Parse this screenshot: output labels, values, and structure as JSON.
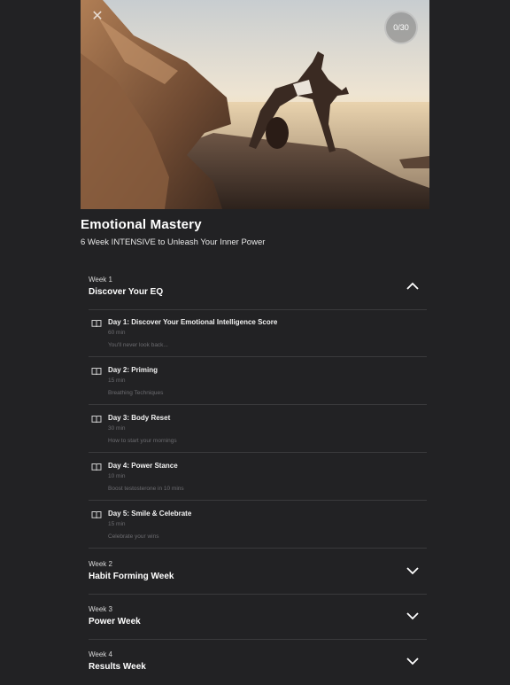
{
  "header": {
    "progress": "0/30"
  },
  "course": {
    "title": "Emotional Mastery",
    "subtitle": "6 Week INTENSIVE to Unleash Your Inner Power"
  },
  "weeks": [
    {
      "label": "Week 1",
      "title": "Discover Your EQ",
      "expanded": true,
      "lessons": [
        {
          "title": "Day 1: Discover Your Emotional Intelligence Score",
          "duration": "60 min",
          "description": "You'll never look back..."
        },
        {
          "title": "Day 2: Priming",
          "duration": "15 min",
          "description": "Breathing Techniques"
        },
        {
          "title": "Day 3: Body Reset",
          "duration": "30 min",
          "description": "How to start your mornings"
        },
        {
          "title": "Day 4: Power Stance",
          "duration": "10 min",
          "description": "Boost testosterone in 10 mins"
        },
        {
          "title": "Day 5: Smile & Celebrate",
          "duration": "15 min",
          "description": "Celebrate your wins"
        }
      ]
    },
    {
      "label": "Week 2",
      "title": "Habit Forming Week",
      "expanded": false
    },
    {
      "label": "Week 3",
      "title": "Power Week",
      "expanded": false
    },
    {
      "label": "Week 4",
      "title": "Results Week",
      "expanded": false
    }
  ],
  "icons": {
    "close": "close-icon",
    "chevron_up": "chevron-up-icon",
    "chevron_down": "chevron-down-icon",
    "lesson": "book-icon"
  }
}
